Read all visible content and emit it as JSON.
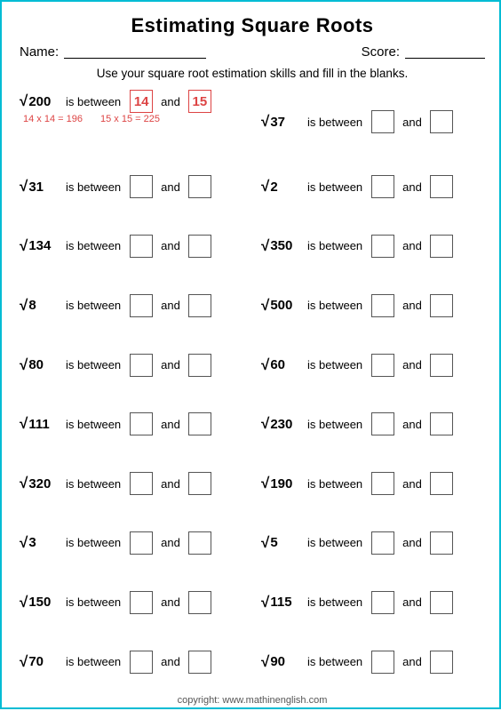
{
  "title": "Estimating Square Roots",
  "nameLabel": "Name:",
  "scoreLabel": "Score:",
  "instructions": "Use your square root estimation skills and fill in the blanks.",
  "hint1": "14 x 14 = 196",
  "hint2": "15 x 15 = 225",
  "problems": [
    {
      "id": "p1",
      "num": "200",
      "ans1": "14",
      "ans2": "15",
      "filled": true,
      "hints": [
        "14 x 14 = 196",
        "15 x 15 = 225"
      ]
    },
    {
      "id": "p2",
      "num": "37",
      "ans1": "",
      "ans2": "",
      "filled": false
    },
    {
      "id": "p3",
      "num": "31",
      "ans1": "",
      "ans2": "",
      "filled": false
    },
    {
      "id": "p4",
      "num": "2",
      "ans1": "",
      "ans2": "",
      "filled": false
    },
    {
      "id": "p5",
      "num": "134",
      "ans1": "",
      "ans2": "",
      "filled": false
    },
    {
      "id": "p6",
      "num": "350",
      "ans1": "",
      "ans2": "",
      "filled": false
    },
    {
      "id": "p7",
      "num": "8",
      "ans1": "",
      "ans2": "",
      "filled": false
    },
    {
      "id": "p8",
      "num": "500",
      "ans1": "",
      "ans2": "",
      "filled": false
    },
    {
      "id": "p9",
      "num": "80",
      "ans1": "",
      "ans2": "",
      "filled": false
    },
    {
      "id": "p10",
      "num": "60",
      "ans1": "",
      "ans2": "",
      "filled": false
    },
    {
      "id": "p11",
      "num": "111",
      "ans1": "",
      "ans2": "",
      "filled": false
    },
    {
      "id": "p12",
      "num": "230",
      "ans1": "",
      "ans2": "",
      "filled": false
    },
    {
      "id": "p13",
      "num": "320",
      "ans1": "",
      "ans2": "",
      "filled": false
    },
    {
      "id": "p14",
      "num": "190",
      "ans1": "",
      "ans2": "",
      "filled": false
    },
    {
      "id": "p15",
      "num": "3",
      "ans1": "",
      "ans2": "",
      "filled": false
    },
    {
      "id": "p16",
      "num": "5",
      "ans1": "",
      "ans2": "",
      "filled": false
    },
    {
      "id": "p17",
      "num": "150",
      "ans1": "",
      "ans2": "",
      "filled": false
    },
    {
      "id": "p18",
      "num": "115",
      "ans1": "",
      "ans2": "",
      "filled": false
    },
    {
      "id": "p19",
      "num": "70",
      "ans1": "",
      "ans2": "",
      "filled": false
    },
    {
      "id": "p20",
      "num": "90",
      "ans1": "",
      "ans2": "",
      "filled": false
    }
  ],
  "copyright": "copyright:    www.mathinenglish.com",
  "andLabel": "and",
  "isBetweenLabel": "is between"
}
